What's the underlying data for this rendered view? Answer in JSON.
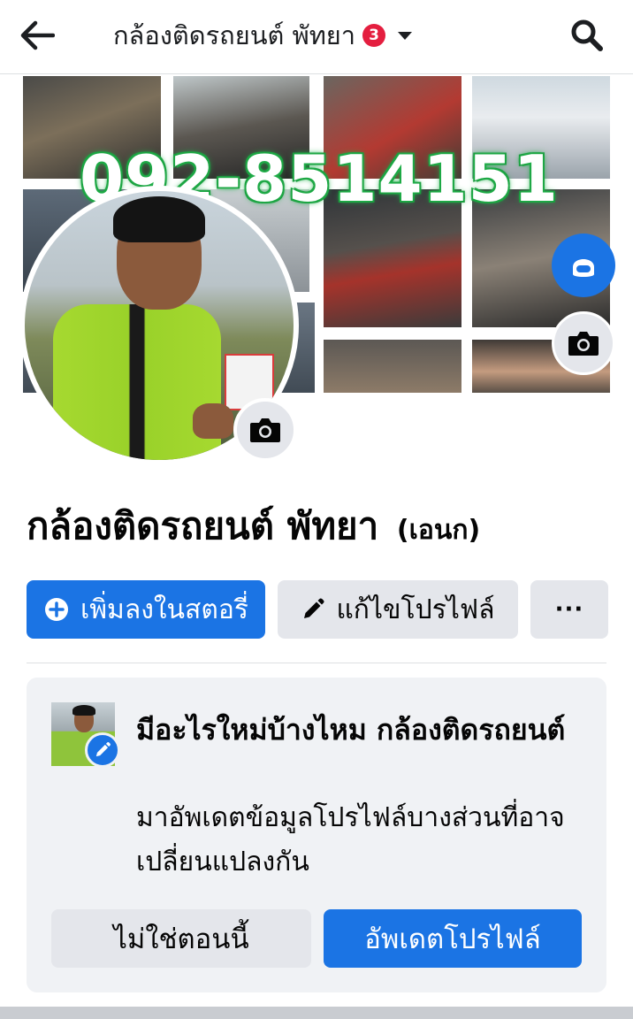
{
  "header": {
    "title": "กล้องติดรถยนต์ พัทยา",
    "notification_count": "3",
    "back_icon": "back-arrow-icon",
    "search_icon": "search-icon"
  },
  "cover": {
    "phone_overlay": "092-8514151"
  },
  "profile": {
    "name": "กล้องติดรถยนต์ พัทยา",
    "alt_name": "(เอนก)"
  },
  "actions": {
    "add_story_label": "เพิ่มลงในสตอรี่",
    "edit_profile_label": "แก้ไขโปรไฟล์",
    "more_label": "···"
  },
  "update_card": {
    "title": "มีอะไรใหม่บ้างไหม กล้องติดรถยนต์",
    "description": "มาอัพเดตข้อมูลโปรไฟล์บางส่วนที่อาจเปลี่ยนแปลงกัน",
    "not_now_label": "ไม่ใช่ตอนนี้",
    "update_label": "อัพเดตโปรไฟล์"
  },
  "colors": {
    "primary": "#1b74e4",
    "secondary_button": "#e4e6eb",
    "badge": "#e41e3f",
    "card_bg": "#f0f2f5",
    "overlay_green": "#22b14c"
  }
}
